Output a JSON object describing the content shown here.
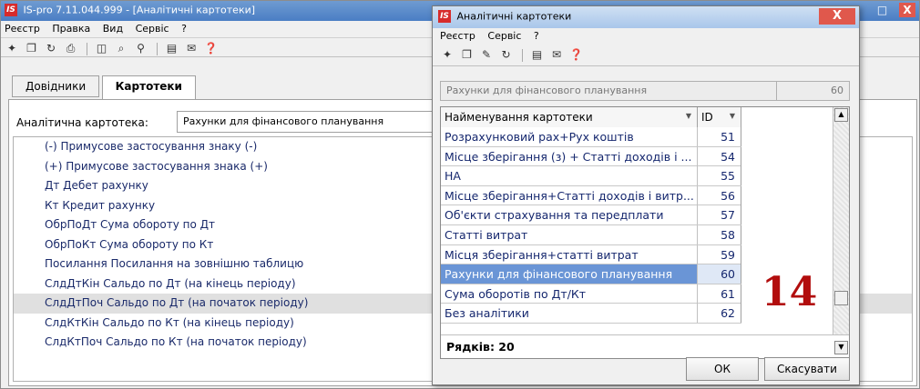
{
  "main_window": {
    "logo": "IS",
    "title": "IS-pro 7.11.044.999 - [Аналітичні картотеки]",
    "controls": {
      "minimize": "_",
      "maximize": "□",
      "close": "X"
    },
    "menu": [
      "Реєстр",
      "Правка",
      "Вид",
      "Сервіс",
      "?"
    ],
    "toolbar_icons": [
      "new-doc-icon",
      "copy-doc-icon",
      "refresh-icon",
      "print-icon",
      "columns-icon",
      "search-icon",
      "filter-icon",
      "form-icon",
      "mail-icon",
      "help-icon"
    ]
  },
  "tabs": [
    {
      "label": "Довідники",
      "active": false
    },
    {
      "label": "Картотеки",
      "active": true
    }
  ],
  "analytic_card": {
    "label": "Аналітична картотека:",
    "value": "Рахунки для фінансового планування"
  },
  "fields": [
    "(-) Примусове застосування знаку (-)",
    "(+) Примусове застосування знака (+)",
    "Дт Дебет рахунку",
    "Кт Кредит рахунку",
    "ОбрПоДт Сума обороту по Дт",
    "ОбрПоКт Сума обороту по Кт",
    "Посилання Посилання на зовнішню таблицю",
    "СлдДтКін Сальдо по Дт (на кінець періоду)",
    "СлдДтПоч Сальдо по Дт (на початок періоду)",
    "СлдКтКін Сальдо по Кт (на кінець періоду)",
    "СлдКтПоч Сальдо по Кт (на початок періоду)"
  ],
  "fields_selected_index": 8,
  "dialog": {
    "logo": "IS",
    "title": "Аналітичні картотеки",
    "close": "X",
    "menu": [
      "Реєстр",
      "Сервіс",
      "?"
    ],
    "toolbar_icons": [
      "new-doc-icon",
      "copy-doc-icon",
      "edit-doc-icon",
      "refresh-icon",
      "form-icon",
      "mail-icon",
      "help-icon"
    ],
    "info_text": "Рахунки для фінансового планування",
    "info_number": "60",
    "columns": {
      "name": "Найменування картотеки",
      "id": "ID"
    },
    "rows": [
      {
        "name": "Розрахунковий рах+Рух коштів",
        "id": "51"
      },
      {
        "name": "Місце зберігання (з) + Статті доходів і ...",
        "id": "54"
      },
      {
        "name": "НА",
        "id": "55"
      },
      {
        "name": "Місце зберігання+Статті доходів і витр...",
        "id": "56"
      },
      {
        "name": "Об'єкти страхування та передплати",
        "id": "57"
      },
      {
        "name": "Статті витрат",
        "id": "58"
      },
      {
        "name": "Місця зберігання+статті витрат",
        "id": "59"
      },
      {
        "name": "Рахунки для фінансового планування",
        "id": "60"
      },
      {
        "name": "Сума оборотів по Дт/Кт",
        "id": "61"
      },
      {
        "name": "Без аналітики",
        "id": "62"
      }
    ],
    "selected_row_index": 7,
    "footer": "Рядків: 20",
    "ok_label": "ОК",
    "cancel_label": "Скасувати",
    "annotation": "14"
  }
}
